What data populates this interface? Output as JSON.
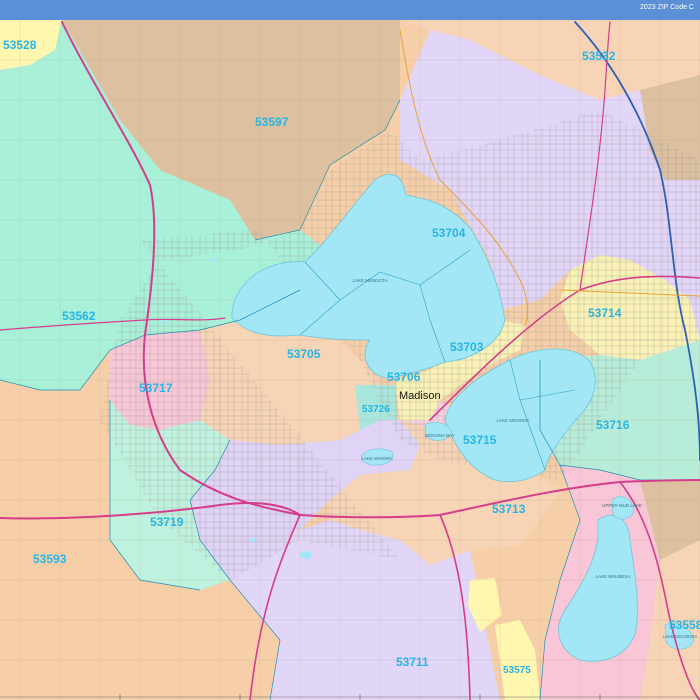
{
  "header": {
    "title": "2023 ZIP Code C"
  },
  "map": {
    "city_label": "Madison",
    "zip_labels": [
      "53528",
      "53532",
      "53597",
      "53704",
      "53562",
      "53714",
      "53705",
      "53703",
      "53717",
      "53706",
      "53726",
      "53716",
      "53715",
      "53713",
      "53719",
      "53593",
      "53558",
      "53711",
      "53575"
    ],
    "lake_labels": {
      "mendota": "LAKE MENDOTA",
      "monona": "LAKE MONONA",
      "wingra": "LAKE WINGRA",
      "waubesa": "LAKE WAUBESA",
      "upper_mud": "UPPER MUD LAKE",
      "monona_bay": "MONONA BAY",
      "kegonsa": "LAKE KEGONSA"
    },
    "colors": {
      "water": "#a3e7f7",
      "highway": "#d43d8c",
      "zip_text": "#27b5e6",
      "header_bar": "#5b8fd6"
    }
  }
}
